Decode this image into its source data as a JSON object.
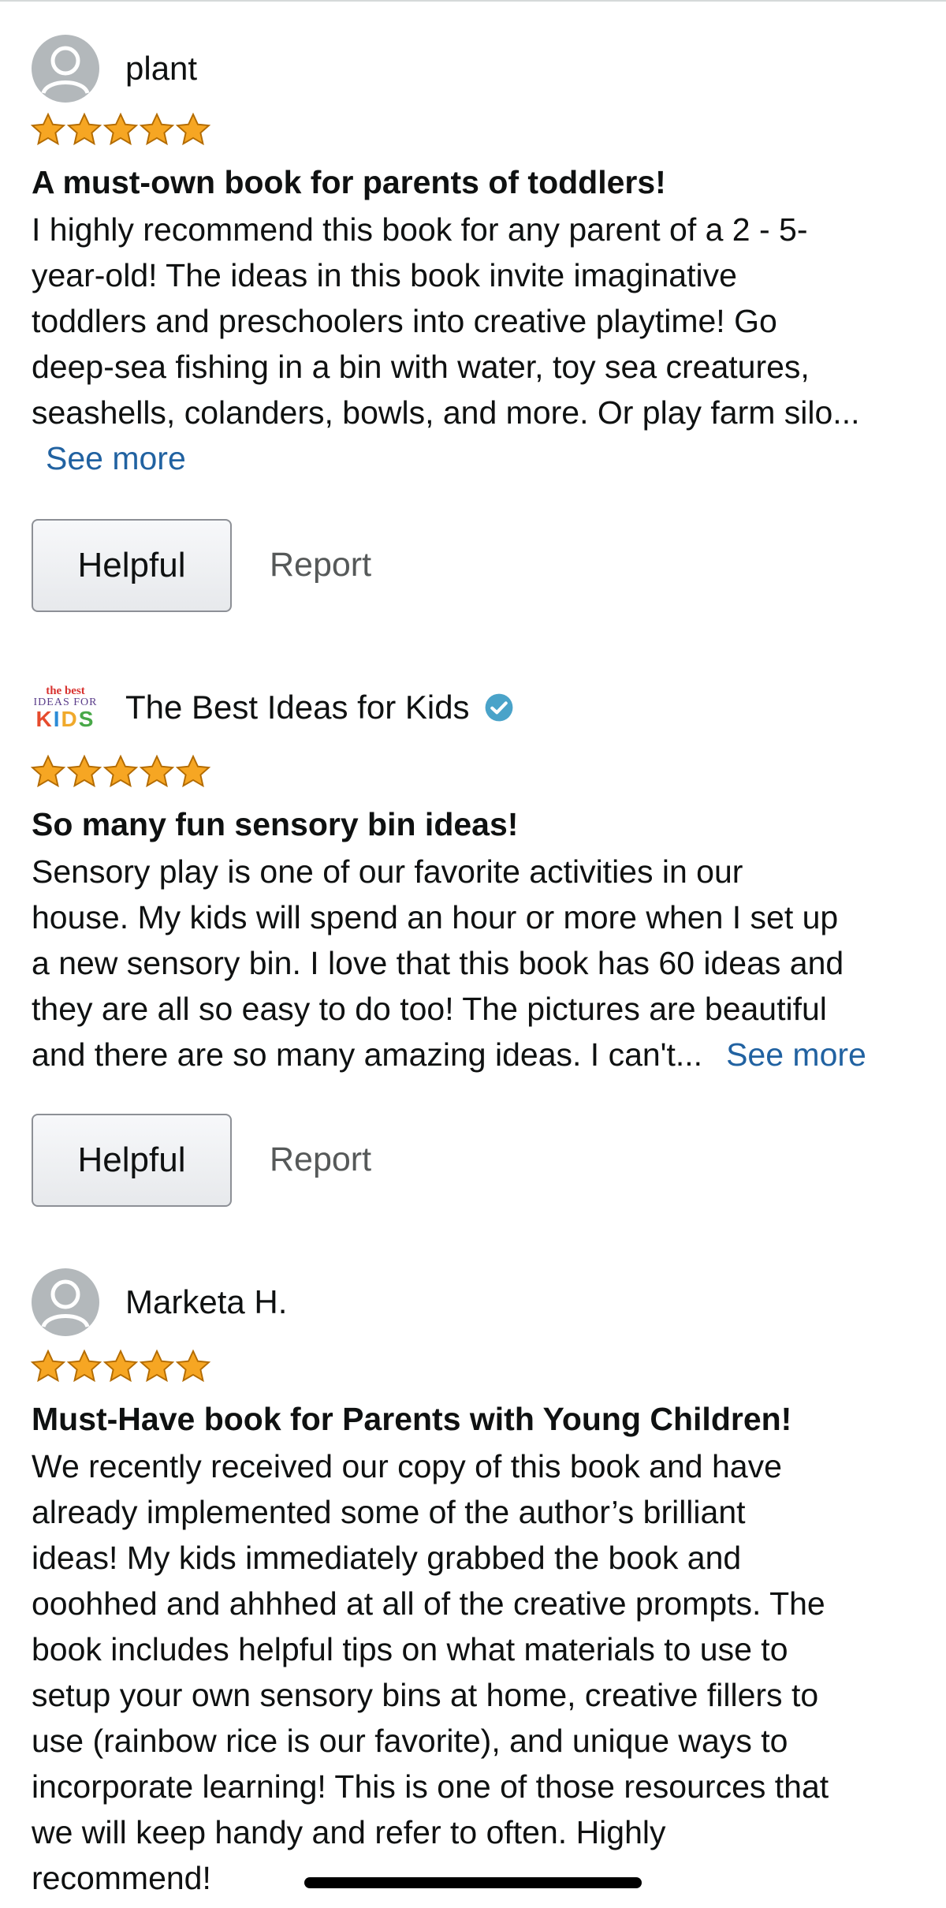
{
  "colors": {
    "link": "#2162a1",
    "star": "#f6a623",
    "avatar": "#b3b8bb",
    "verified": "#4aa3c9"
  },
  "reviews": [
    {
      "reviewer": "plant",
      "avatar_icon": "default-user-avatar",
      "rating": 5,
      "title": "A must-own book for parents of toddlers!",
      "body_lines": [
        "I highly recommend this book for any parent of a 2 - 5-",
        "year-old! The ideas in this book invite imaginative",
        "toddlers and preschoolers into creative playtime! Go",
        "deep-sea fishing in a bin with water, toy sea creatures,",
        "seashells, colanders, bowls, and more. Or play farm silo..."
      ],
      "see_more": "See more",
      "helpful_label": "Helpful",
      "report_label": "Report"
    },
    {
      "reviewer": "The Best Ideas for Kids",
      "logo_text": {
        "line1": "the best",
        "line2": "IDEAS FOR",
        "line3": "KIDS"
      },
      "verified_icon": "verified-check-icon",
      "rating": 5,
      "title": "So many fun sensory bin ideas!",
      "body_lines": [
        "Sensory play is one of our favorite activities in our",
        "house. My kids will spend an hour or more when I set up",
        "a new sensory bin. I love that this book has 60 ideas and",
        "they are all so easy to do too! The pictures are beautiful",
        "and there are so many amazing ideas. I can't..."
      ],
      "see_more": "See more",
      "helpful_label": "Helpful",
      "report_label": "Report"
    },
    {
      "reviewer": "Marketa H.",
      "avatar_icon": "default-user-avatar",
      "rating": 5,
      "title": "Must-Have book for Parents with Young Children!",
      "body_lines": [
        "We recently received our copy of this book and have",
        "already implemented some of the author’s brilliant",
        "ideas! My kids immediately grabbed the book and",
        "ooohhed and ahhhed at all of the creative prompts. The",
        "book includes helpful tips on what materials to use to",
        "setup your own sensory bins at home, creative fillers to",
        "use (rainbow rice is our favorite), and unique ways to",
        "incorporate learning! This is one of those resources that",
        "we will keep handy and refer to often. Highly",
        "recommend!"
      ]
    }
  ]
}
